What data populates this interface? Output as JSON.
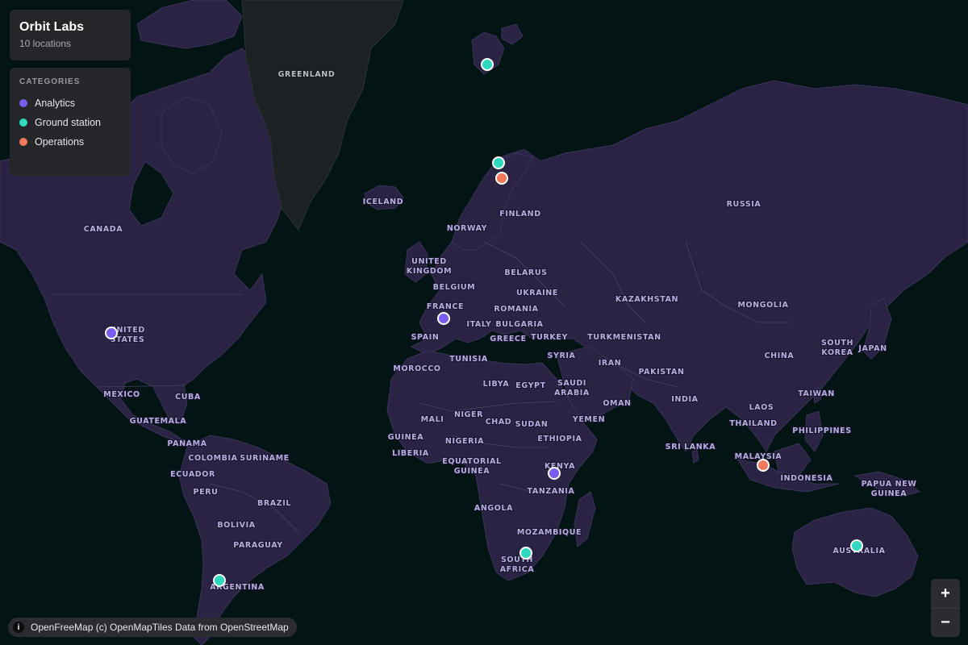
{
  "header": {
    "title": "Orbit Labs",
    "subtitle": "10 locations"
  },
  "legend": {
    "title": "CATEGORIES",
    "items": [
      {
        "label": "Analytics",
        "color": "#7b5cf0"
      },
      {
        "label": "Ground station",
        "color": "#2fd9c0"
      },
      {
        "label": "Operations",
        "color": "#f2785c"
      }
    ]
  },
  "attribution": {
    "icon": "info-icon",
    "text": "OpenFreeMap (c) OpenMapTiles Data from OpenStreetMap"
  },
  "zoom": {
    "in_label": "+",
    "out_label": "−"
  },
  "map": {
    "colors": {
      "water": "#031414",
      "land": "#2a2343",
      "greenland": "#1c2124",
      "labels": "#b7aee0"
    },
    "country_labels": [
      "GREENLAND",
      "ICELAND",
      "CANADA",
      "UNITED",
      "STATES",
      "MEXICO",
      "CUBA",
      "GUATEMALA",
      "PANAMA",
      "COLOMBIA",
      "SURINAME",
      "ECUADOR",
      "PERU",
      "BRAZIL",
      "BOLIVIA",
      "PARAGUAY",
      "ARGENTINA",
      "NORWAY",
      "FINLAND",
      "RUSSIA",
      "UNITED",
      "KINGDOM",
      "BELARUS",
      "BELGIUM",
      "UKRAINE",
      "FRANCE",
      "ROMANIA",
      "ITALY",
      "BULGARIA",
      "SPAIN",
      "GREECE",
      "TURKEY",
      "TUNISIA",
      "SYRIA",
      "MOROCCO",
      "LIBYA",
      "EGYPT",
      "SAUDI",
      "ARABIA",
      "MALI",
      "NIGER",
      "CHAD",
      "SUDAN",
      "GUINEA",
      "NIGERIA",
      "LIBERIA",
      "ETHIOPIA",
      "EQUATORIAL",
      "GUINEA",
      "KENYA",
      "TANZANIA",
      "ANGOLA",
      "MOZAMBIQUE",
      "SOUTH",
      "AFRICA",
      "KAZAKHSTAN",
      "MONGOLIA",
      "TURKMENISTAN",
      "IRAN",
      "PAKISTAN",
      "CHINA",
      "SOUTH",
      "KOREA",
      "JAPAN",
      "INDIA",
      "OMAN",
      "YEMEN",
      "TAIWAN",
      "LAOS",
      "THAILAND",
      "PHILIPPINES",
      "SRI LANKA",
      "MALAYSIA",
      "INDONESIA",
      "PAPUA NEW",
      "GUINEA",
      "AUSTRALIA"
    ],
    "markers": [
      {
        "name": "svalbard",
        "category": "Ground station",
        "color": "#2fd9c0"
      },
      {
        "name": "northern-norway",
        "category": "Ground station",
        "color": "#2fd9c0"
      },
      {
        "name": "northern-finland",
        "category": "Operations",
        "color": "#f2785c"
      },
      {
        "name": "united-states",
        "category": "Analytics",
        "color": "#7b5cf0"
      },
      {
        "name": "france",
        "category": "Analytics",
        "color": "#7b5cf0"
      },
      {
        "name": "kenya",
        "category": "Analytics",
        "color": "#7b5cf0"
      },
      {
        "name": "malaysia",
        "category": "Operations",
        "color": "#f2785c"
      },
      {
        "name": "south-africa",
        "category": "Ground station",
        "color": "#2fd9c0"
      },
      {
        "name": "argentina",
        "category": "Ground station",
        "color": "#2fd9c0"
      },
      {
        "name": "australia",
        "category": "Ground station",
        "color": "#2fd9c0"
      }
    ]
  }
}
